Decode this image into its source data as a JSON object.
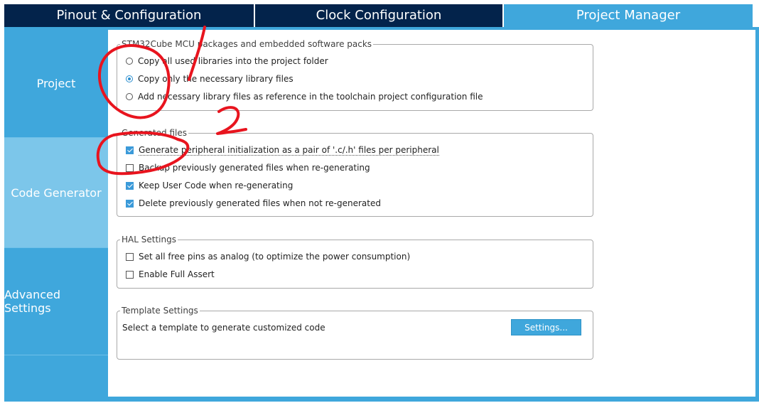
{
  "tabs": [
    {
      "label": "Pinout & Configuration"
    },
    {
      "label": "Clock Configuration"
    },
    {
      "label": "Project Manager"
    }
  ],
  "sidebar": {
    "items": [
      {
        "label": "Project"
      },
      {
        "label": "Code Generator"
      },
      {
        "label": "Advanced Settings"
      }
    ]
  },
  "packs": {
    "legend": "STM32Cube MCU packages and embedded software packs",
    "options": [
      {
        "label": "Copy all used libraries into the project folder",
        "selected": false
      },
      {
        "label": "Copy only the necessary library files",
        "selected": true
      },
      {
        "label": "Add necessary library files as reference in the toolchain project configuration file",
        "selected": false
      }
    ]
  },
  "generated": {
    "legend": "Generated files",
    "options": [
      {
        "label": "Generate peripheral initialization as a pair of '.c/.h' files per peripheral",
        "checked": true
      },
      {
        "label": "Backup previously generated files when re-generating",
        "checked": false
      },
      {
        "label": "Keep User Code when re-generating",
        "checked": true
      },
      {
        "label": "Delete previously generated files when not re-generated",
        "checked": true
      }
    ]
  },
  "hal": {
    "legend": "HAL Settings",
    "options": [
      {
        "label": "Set all free pins as analog (to optimize the power consumption)",
        "checked": false
      },
      {
        "label": "Enable Full Assert",
        "checked": false
      }
    ]
  },
  "template": {
    "legend": "Template Settings",
    "text": "Select a template to generate customized code",
    "button_label": "Settings..."
  },
  "annotations": {
    "mark_1": "1",
    "mark_2": "2",
    "color": "#e8141e"
  },
  "colors": {
    "tab_dark": "#03234b",
    "accent": "#3fa7dc",
    "nav_active": "#7cc6ea"
  }
}
